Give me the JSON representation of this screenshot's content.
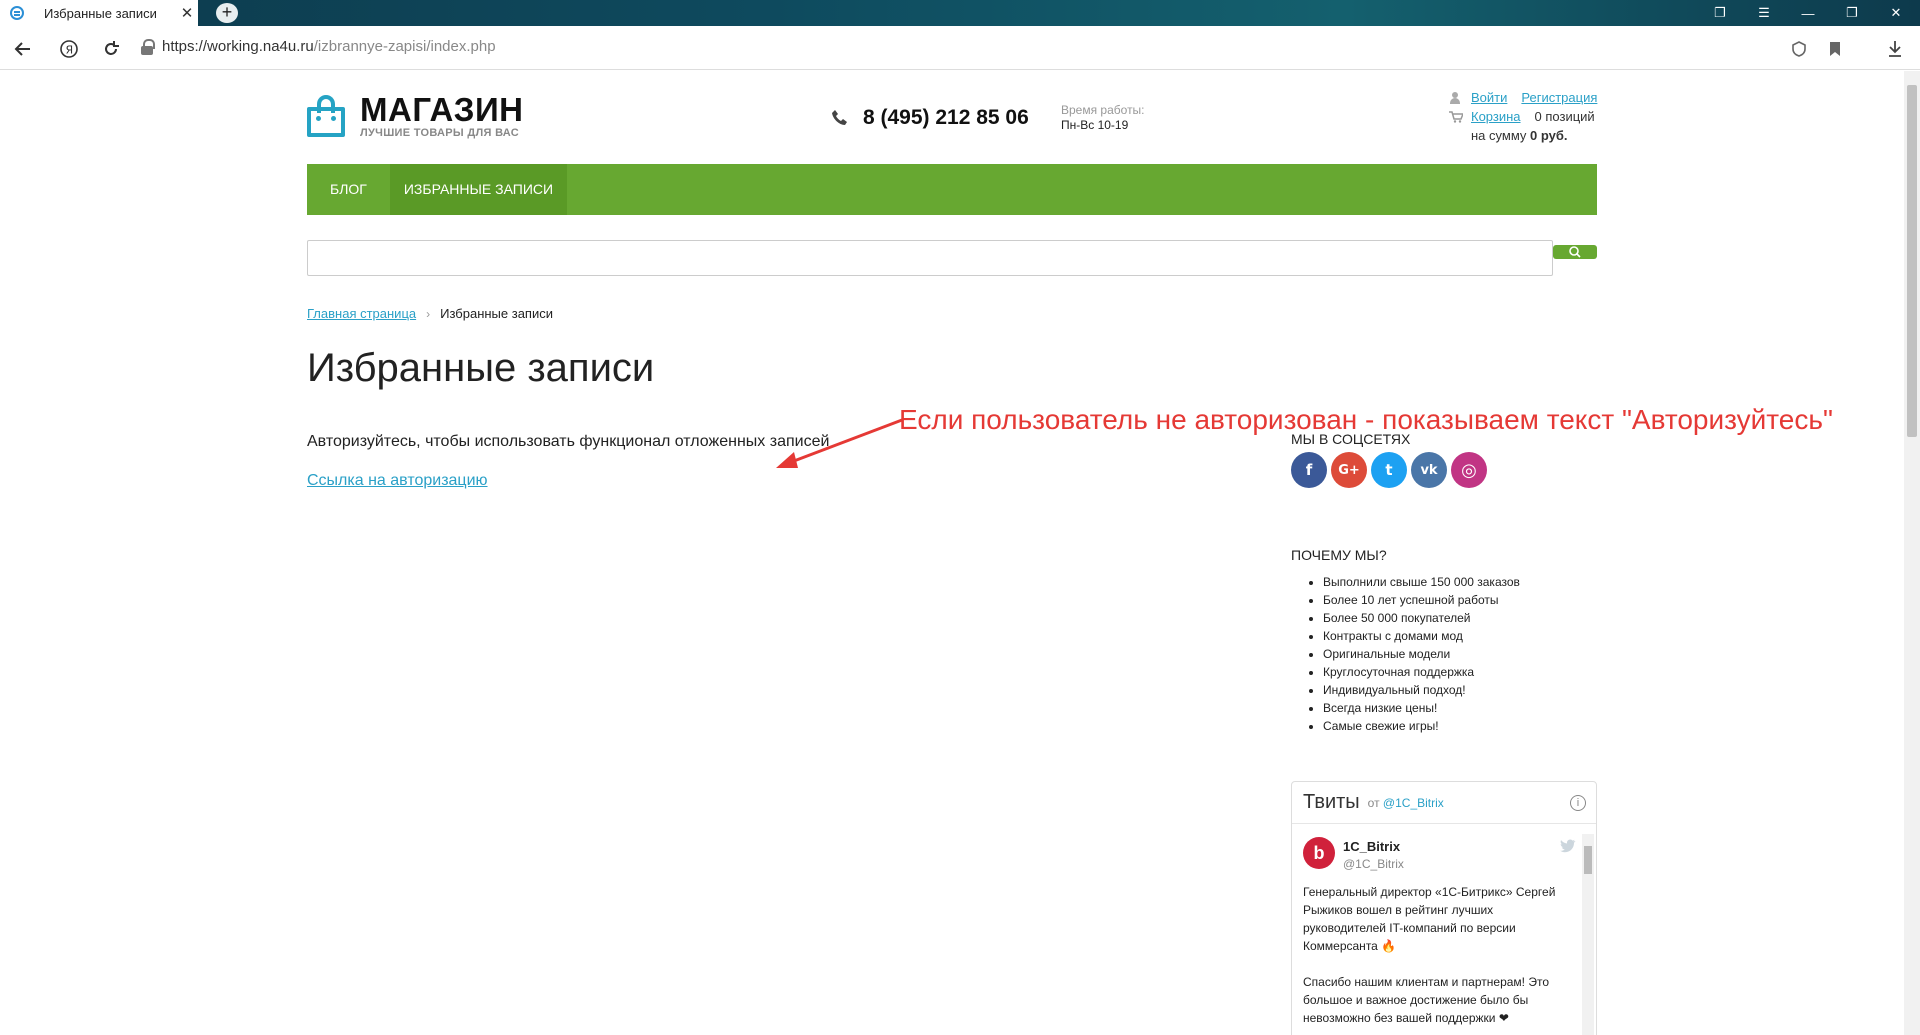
{
  "browser": {
    "tab_title": "Избранные записи",
    "tab_close": "✕",
    "new_tab": "+",
    "url_host": "https://working.na4u.ru",
    "url_path": "/izbrannye-zapisi/index.php"
  },
  "header": {
    "logo_name": "МАГАЗИН",
    "logo_tagline": "ЛУЧШИЕ ТОВАРЫ ДЛЯ ВАС",
    "phone": "8 (495) 212 85 06",
    "hours_label": "Время работы:",
    "hours_value": "Пн-Вс 10-19",
    "login": "Войти",
    "register": "Регистрация",
    "cart": "Корзина",
    "cart_count": "0 позиций",
    "cart_sum_prefix": "на сумму",
    "cart_sum": "0 руб."
  },
  "menu": [
    {
      "label": "Блог",
      "active": false
    },
    {
      "label": "Избранные записи",
      "active": true
    }
  ],
  "search": {
    "value": "",
    "placeholder": ""
  },
  "breadcrumb": {
    "home": "Главная страница",
    "separator": "›",
    "current": "Избранные записи"
  },
  "main": {
    "title": "Избранные записи",
    "notice": "Авторизуйтесь, чтобы использовать функционал отложенных записей",
    "auth_link": "Ссылка на авторизацию"
  },
  "annotation": "Если пользователь не авторизован - показываем текст \"Авторизуйтесь\"",
  "sidebar": {
    "social_heading": "Мы в соцсетях",
    "socials": [
      {
        "name": "facebook",
        "glyph": "f",
        "color": "#3b5998"
      },
      {
        "name": "google-plus",
        "glyph": "G+",
        "color": "#dd4b39"
      },
      {
        "name": "twitter",
        "glyph": "t",
        "color": "#1da1f2"
      },
      {
        "name": "vk",
        "glyph": "vk",
        "color": "#4a76a8"
      },
      {
        "name": "instagram",
        "glyph": "◎",
        "color": "#c13584"
      }
    ],
    "why_heading": "Почему мы?",
    "why_items": [
      "Выполнили свыше 150 000 заказов",
      "Более 10 лет успешной работы",
      "Более 50 000 покупателей",
      "Контракты с домами мод",
      "Оригинальные модели",
      "Круглосуточная поддержка",
      "Индивидуальный подход!",
      "Всегда низкие цены!",
      "Самые свежие игры!"
    ],
    "twitter": {
      "title": "Твиты",
      "by_prefix": "от",
      "by_handle": "@1C_Bitrix",
      "info": "i",
      "name": "1C_Bitrix",
      "handle": "@1C_Bitrix",
      "avatar": "b",
      "paragraph1": "Генеральный директор «1С-Битрикс» Сергей Рыжиков вошел в рейтинг лучших руководителей IT-компаний по версии Коммерсанта 🔥",
      "paragraph2": "Спасибо нашим клиентам и партнерам! Это большое и важное достижение было бы невозможно без вашей поддержки ❤"
    }
  }
}
